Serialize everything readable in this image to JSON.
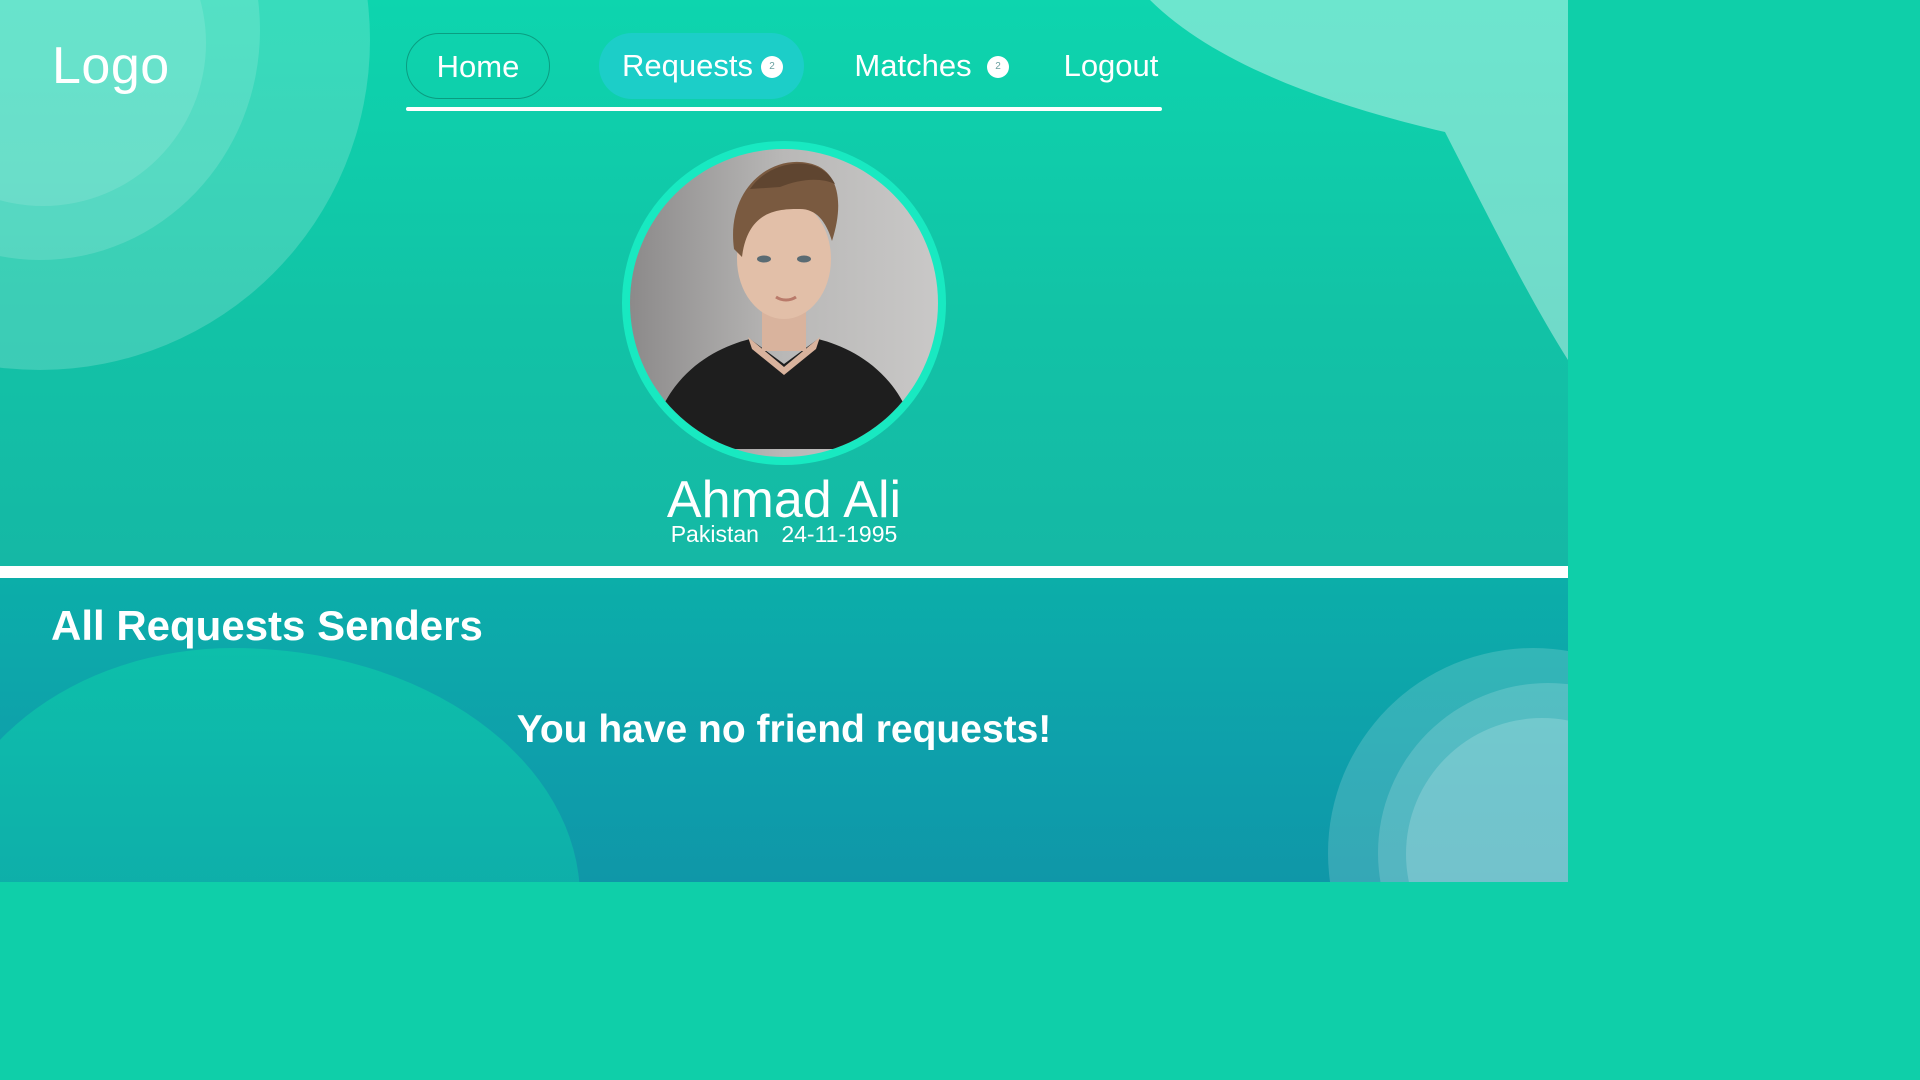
{
  "header": {
    "logo": "Logo",
    "nav": {
      "home": "Home",
      "requests": "Requests",
      "requests_badge": "2",
      "matches": "Matches",
      "matches_badge": "2",
      "logout": "Logout"
    }
  },
  "profile": {
    "name": "Ahmad Ali",
    "country": "Pakistan",
    "dob": "24-11-1995"
  },
  "requests_section": {
    "title": "All Requests Senders",
    "empty_message": "You have no friend requests!"
  },
  "colors": {
    "accent": "#0fcfa9",
    "active_tab": "#1ccec8",
    "avatar_ring": "#18e9c1"
  }
}
